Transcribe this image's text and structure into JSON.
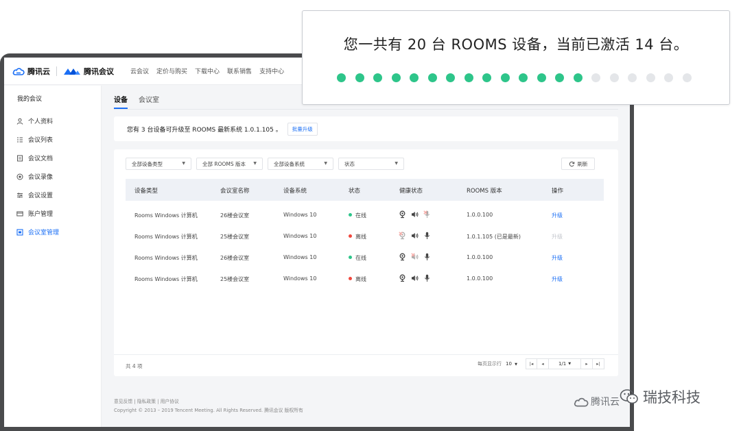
{
  "header": {
    "brand_tencent_cloud": "腾讯云",
    "brand_tencent_meeting": "腾讯会议",
    "nav": [
      "云会议",
      "定价与购买",
      "下载中心",
      "联系销售",
      "支持中心"
    ]
  },
  "sidebar": {
    "title": "我的会议",
    "items": [
      {
        "label": "个人资料",
        "icon": "user-icon"
      },
      {
        "label": "会议列表",
        "icon": "list-icon"
      },
      {
        "label": "会议文档",
        "icon": "document-icon"
      },
      {
        "label": "会议录像",
        "icon": "record-icon"
      },
      {
        "label": "会议设置",
        "icon": "settings-icon"
      },
      {
        "label": "账户管理",
        "icon": "card-icon"
      },
      {
        "label": "会议室管理",
        "icon": "room-icon",
        "active": true
      }
    ]
  },
  "tabs": [
    {
      "label": "设备",
      "active": true
    },
    {
      "label": "会议室",
      "active": false
    }
  ],
  "banner": {
    "text": "您有 3 台设备可升级至 ROOMS 最新系统 1.0.1.105 。",
    "button": "批量升级"
  },
  "filters": [
    "全部设备类型",
    "全部 ROOMS 版本",
    "全部设备系统",
    "状态"
  ],
  "refresh_label": "刷新",
  "table": {
    "columns": [
      "设备类型",
      "会议室名称",
      "设备系统",
      "状态",
      "健康状态",
      "ROOMS 版本",
      "操作"
    ],
    "rows": [
      {
        "type": "Rooms Windows 计算机",
        "room": "26楼会议室",
        "os": "Windows 10",
        "status": "在线",
        "status_color": "#2ec58a",
        "health": [
          "camera-ok",
          "speaker-ok",
          "mic-error"
        ],
        "version": "1.0.0.100",
        "action": "升级",
        "action_enabled": true
      },
      {
        "type": "Rooms Windows 计算机",
        "room": "25楼会议室",
        "os": "Windows 10",
        "status": "离线",
        "status_color": "#f0483e",
        "health": [
          "camera-error",
          "speaker-ok",
          "mic-ok"
        ],
        "version": "1.0.1.105 (已是最新)",
        "action": "升级",
        "action_enabled": false
      },
      {
        "type": "Rooms Windows 计算机",
        "room": "26楼会议室",
        "os": "Windows 10",
        "status": "在线",
        "status_color": "#2ec58a",
        "health": [
          "camera-ok",
          "speaker-error",
          "mic-ok"
        ],
        "version": "1.0.0.100",
        "action": "升级",
        "action_enabled": true
      },
      {
        "type": "Rooms Windows 计算机",
        "room": "25楼会议室",
        "os": "Windows 10",
        "status": "离线",
        "status_color": "#f0483e",
        "health": [
          "camera-ok",
          "speaker-ok",
          "mic-ok"
        ],
        "version": "1.0.0.100",
        "action": "升级",
        "action_enabled": true
      }
    ]
  },
  "pagination": {
    "total": "共 4 项",
    "page_size_label": "每页显示行",
    "page_size": "10",
    "page": "1/1"
  },
  "footer": {
    "links": [
      "意见反馈",
      "隐私政策",
      "用户协议"
    ],
    "copyright": "Copyright © 2013 – 2019 Tencent Meeting. All Rights Reserved. 腾讯会议 版权所有"
  },
  "callout": {
    "text": "您一共有 20 台 ROOMS 设备，当前已激活 14 台。",
    "total_devices": 20,
    "active_devices": 14
  },
  "watermarks": {
    "tencent_cloud": "腾讯云",
    "wechat_account": "瑞技科技"
  },
  "colors": {
    "accent": "#1b6ff5",
    "online": "#2ec58a",
    "offline": "#f0483e"
  }
}
